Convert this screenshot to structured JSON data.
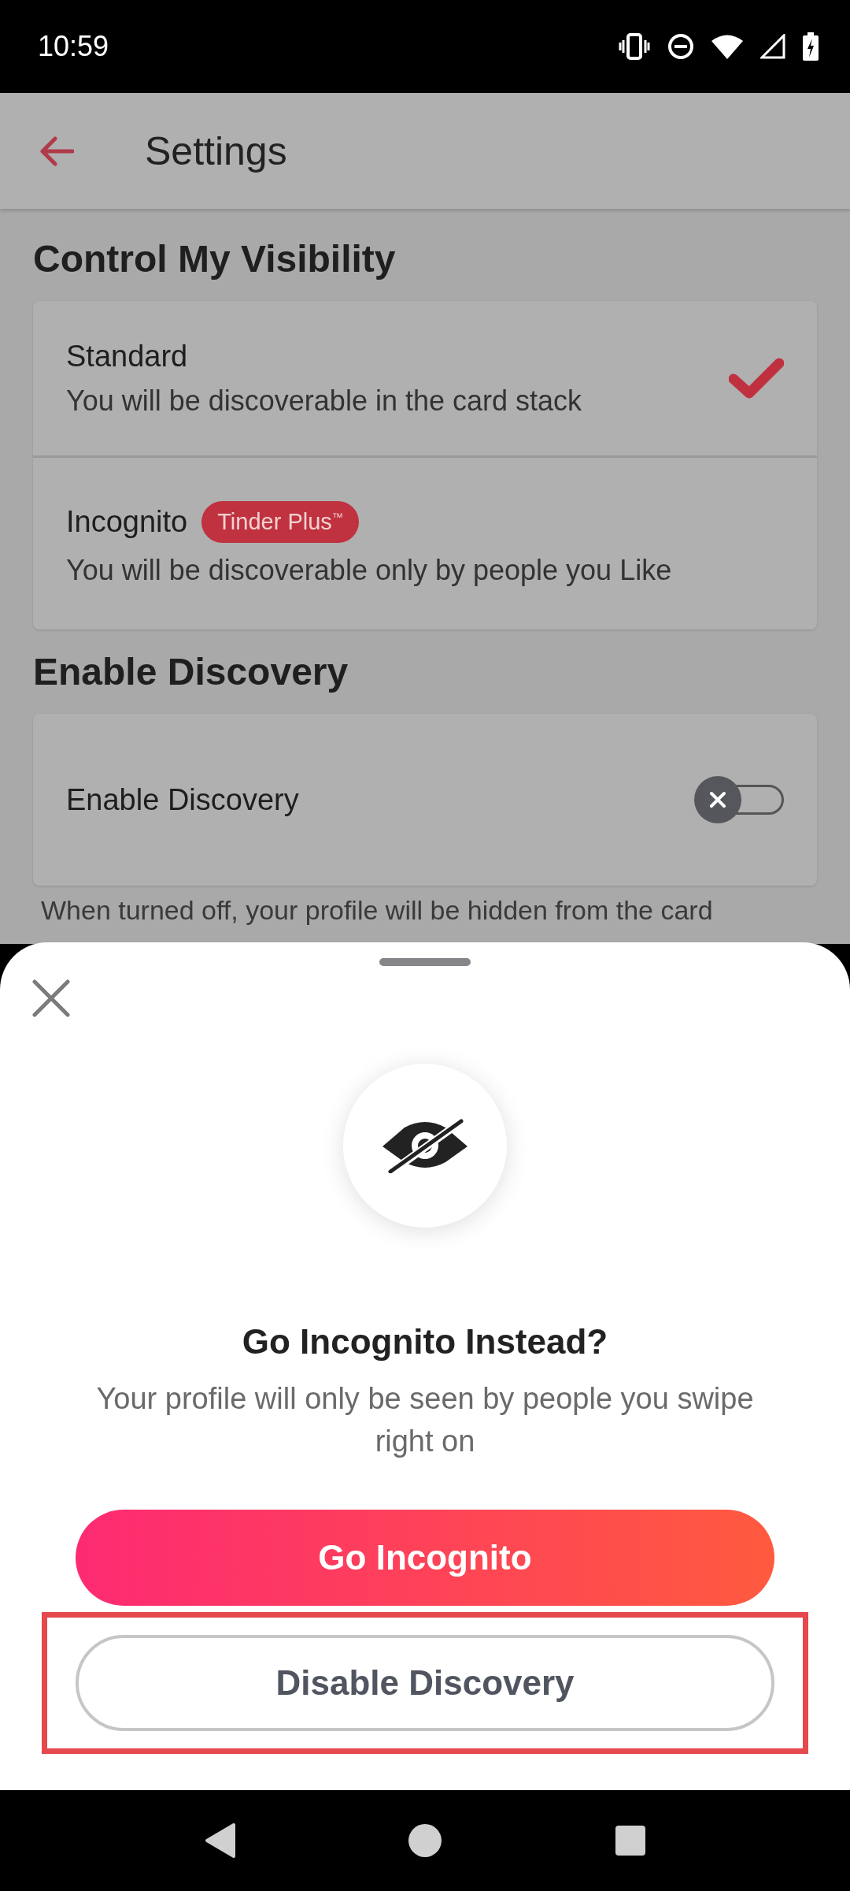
{
  "status_bar": {
    "time": "10:59"
  },
  "header": {
    "title": "Settings"
  },
  "sections": [
    {
      "title": "Control My Visibility",
      "items": [
        {
          "kind": "option",
          "title": "Standard",
          "subtitle": "You will be discoverable in the card stack",
          "selected": true
        },
        {
          "kind": "option",
          "title": "Incognito",
          "badge": "Tinder Plus$^{™}$",
          "subtitle": "You will be discoverable only by people you Like",
          "selected": false
        }
      ]
    },
    {
      "title": "Enable Discovery",
      "items": [
        {
          "kind": "toggle",
          "title": "Enable Discovery",
          "on": false
        }
      ],
      "note": "When turned off, your profile will be hidden from the card"
    }
  ],
  "sheet": {
    "title": "Go Incognito Instead?",
    "body": "Your profile will only be seen by people you swipe right on",
    "buttons": [
      {
        "kind": "primary",
        "label": "Go Incognito",
        "highlighted": false
      },
      {
        "kind": "secondary",
        "label": "Disable Discovery",
        "highlighted": true
      }
    ]
  }
}
